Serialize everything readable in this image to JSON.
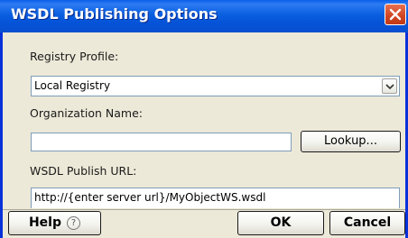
{
  "window": {
    "title": "WSDL Publishing Options"
  },
  "form": {
    "registry_profile_label": "Registry Profile:",
    "registry_profile_value": "Local Registry",
    "organization_name_label": "Organization Name:",
    "organization_name_value": "",
    "lookup_label": "Lookup...",
    "wsdl_url_label": "WSDL Publish URL:",
    "wsdl_url_value": "http://{enter server url}/MyObjectWS.wsdl"
  },
  "footer": {
    "help_label": "Help",
    "help_icon": "?",
    "ok_label": "OK",
    "cancel_label": "Cancel"
  },
  "colors": {
    "titlebar": "#0a5fe0",
    "close": "#d04420",
    "dialog_bg": "#ece9d8"
  }
}
